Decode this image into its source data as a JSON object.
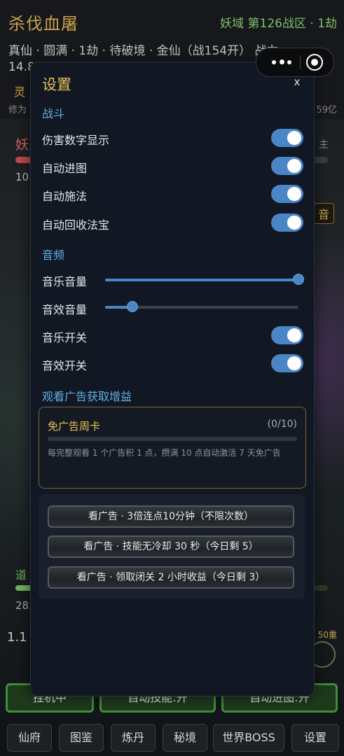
{
  "background": {
    "title": "杀伐血屠",
    "realm": "妖域 第126战区 · 1劫",
    "info_line": "真仙 · 圆满 · 1劫 · 待破境 · 金仙（战154开） 战力",
    "power_value": "14.8",
    "linggen": "灵",
    "xiuwei": "修为",
    "xiuwei_right": "59亿",
    "enemy_label": "妖",
    "enemy_right": "主",
    "enemy_hp": "10",
    "music_badge": "音",
    "dao_label": "道",
    "dao_value": "28.",
    "speed": "1.1",
    "level_badge": "50重",
    "actions": [
      "挂机中",
      "自动技能:开",
      "自动进图:开"
    ],
    "nav": [
      "仙府",
      "图鉴",
      "炼丹",
      "秘境",
      "世界BOSS",
      "设置"
    ]
  },
  "modal": {
    "title": "设置",
    "close": "x",
    "battle_section": "战斗",
    "battle_toggles": [
      {
        "label": "伤害数字显示",
        "on": true
      },
      {
        "label": "自动进图",
        "on": true
      },
      {
        "label": "自动施法",
        "on": true
      },
      {
        "label": "自动回收法宝",
        "on": true
      }
    ],
    "audio_section": "音频",
    "sliders": [
      {
        "label": "音乐音量",
        "value": 1.0
      },
      {
        "label": "音效音量",
        "value": 0.14
      }
    ],
    "audio_toggles": [
      {
        "label": "音乐开关",
        "on": true
      },
      {
        "label": "音效开关",
        "on": true
      }
    ],
    "ads_section": "观看广告获取增益",
    "card": {
      "title": "免广告周卡",
      "count": "(0/10)",
      "progress": 0,
      "desc": "每完整观看 1 个广告积 1 点，攒满 10 点自动激活 7 天免广告"
    },
    "ad_buttons": [
      "看广告 · 3倍连点10分钟（不限次数）",
      "看广告 · 技能无冷却 30 秒（今日剩 5）",
      "看广告 · 领取闭关 2 小时收益（今日剩 3）"
    ]
  },
  "colors": {
    "accent": "#4a86c6",
    "gold": "#e8c25a",
    "section": "#5fb0e6"
  }
}
